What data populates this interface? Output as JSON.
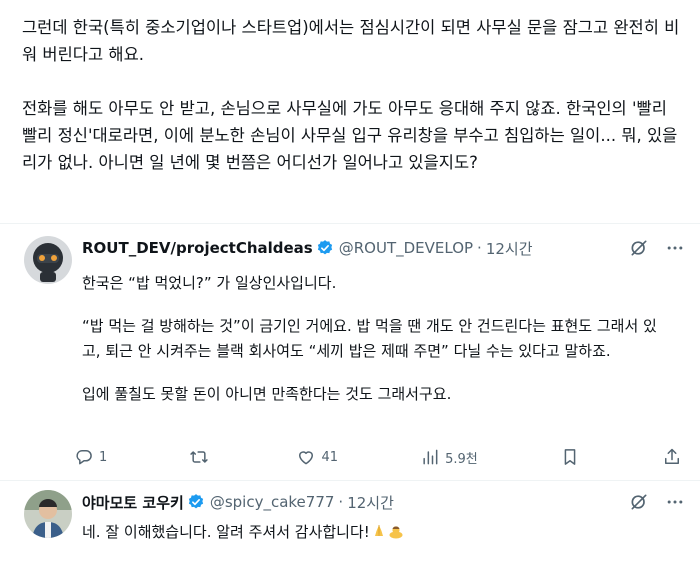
{
  "intro": {
    "paragraph1": "그런데 한국(특히 중소기업이나 스타트업)에서는 점심시간이 되면 사무실 문을 잠그고 완전히 비워 버린다고 해요.",
    "paragraph2": "전화를 해도 아무도 안 받고, 손님으로 사무실에 가도 아무도 응대해 주지 않죠. 한국인의 '빨리빨리 정신'대로라면, 이에 분노한 손님이 사무실 입구 유리창을 부수고 침입하는 일이... 뭐, 있을 리가 없나. 아니면 일 년에 몇 번쯤은 어디선가 일어나고 있을지도?"
  },
  "reply1": {
    "display_name": "ROUT_DEV/projectChaldeas",
    "handle": "@ROUT_DEVELOP",
    "separator": "·",
    "time": "12시간",
    "paragraphs": [
      "한국은 “밥 먹었니?” 가 일상인사입니다.",
      "“밥 먹는 걸 방해하는 것”이 금기인 거에요. 밥 먹을 땐 개도 안 건드린다는 표현도 그래서 있고, 퇴근 안 시켜주는 블랙 회사여도 “세끼 밥은 제때 주면” 다닐 수는 있다고 말하죠.",
      "입에 풀칠도 못할 돈이 아니면 만족한다는 것도 그래서구요."
    ],
    "reply_count": "1",
    "retweet_count": "",
    "like_count": "41",
    "view_count": "5.9천",
    "icons": [
      "grok-icon",
      "more-icon",
      "verified-badge-icon",
      "reply-icon",
      "retweet-icon",
      "like-icon",
      "views-icon",
      "bookmark-icon",
      "share-icon"
    ]
  },
  "reply2": {
    "display_name": "야마모토 코우키",
    "handle": "@spicy_cake777",
    "separator": "·",
    "time": "12시간",
    "text": "네. 잘 이해했습니다. 알려 주셔서 감사합니다!",
    "icons": [
      "grok-icon",
      "more-icon",
      "verified-badge-icon",
      "folded-hands-emoji",
      "bowing-person-emoji"
    ]
  },
  "colors": {
    "text": "#0f1419",
    "secondary": "#536471",
    "verified": "#1d9bf0",
    "divider": "#eff3f4"
  }
}
